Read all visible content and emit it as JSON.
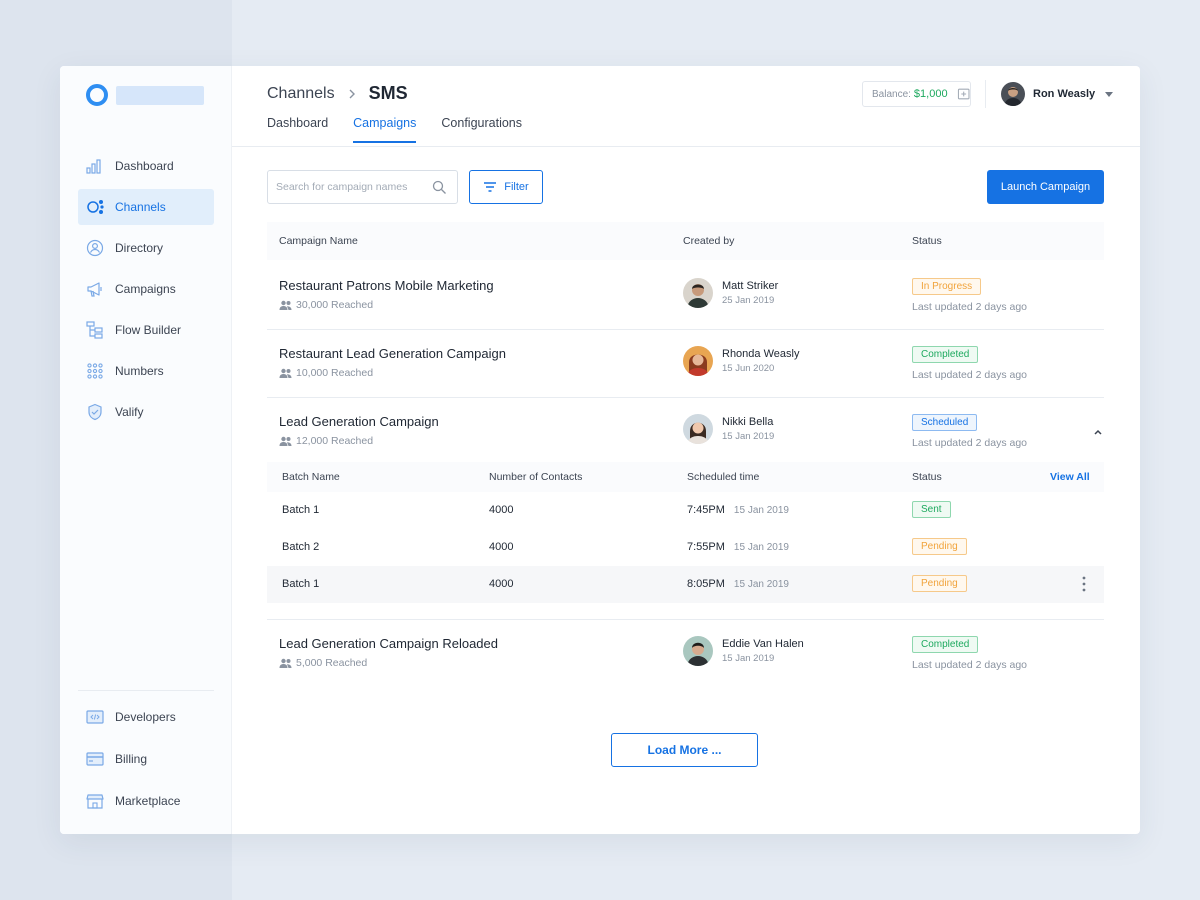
{
  "sidebar": {
    "items": [
      {
        "label": "Dashboard",
        "icon": "bar-chart-icon"
      },
      {
        "label": "Channels",
        "icon": "channels-icon",
        "active": true
      },
      {
        "label": "Directory",
        "icon": "directory-icon"
      },
      {
        "label": "Campaigns",
        "icon": "megaphone-icon"
      },
      {
        "label": "Flow Builder",
        "icon": "flow-builder-icon"
      },
      {
        "label": "Numbers",
        "icon": "dial-pad-icon"
      },
      {
        "label": "Valify",
        "icon": "shield-check-icon"
      }
    ],
    "bottom_items": [
      {
        "label": "Developers",
        "icon": "code-icon"
      },
      {
        "label": "Billing",
        "icon": "credit-card-icon"
      },
      {
        "label": "Marketplace",
        "icon": "store-icon"
      }
    ]
  },
  "header": {
    "breadcrumb_parent": "Channels",
    "breadcrumb_current": "SMS",
    "tabs": [
      {
        "label": "Dashboard"
      },
      {
        "label": "Campaigns",
        "active": true
      },
      {
        "label": "Configurations"
      }
    ],
    "balance_label": "Balance:",
    "balance_value": "$1,000",
    "user_name": "Ron Weasly"
  },
  "toolbar": {
    "search_placeholder": "Search for campaign names",
    "filter_label": "Filter",
    "launch_label": "Launch Campaign"
  },
  "table": {
    "headers": {
      "name": "Campaign Name",
      "created_by": "Created by",
      "status": "Status"
    },
    "rows": [
      {
        "name": "Restaurant Patrons Mobile Marketing",
        "reached": "30,000 Reached",
        "creator": "Matt Striker",
        "date": "25 Jan 2019",
        "status": "In Progress",
        "updated": "Last updated 2 days ago"
      },
      {
        "name": "Restaurant Lead Generation Campaign",
        "reached": "10,000 Reached",
        "creator": "Rhonda Weasly",
        "date": "15 Jun 2020",
        "status": "Completed",
        "updated": "Last updated 2 days ago"
      },
      {
        "name": "Lead Generation Campaign",
        "reached": "12,000 Reached",
        "creator": "Nikki Bella",
        "date": "15 Jan 2019",
        "status": "Scheduled",
        "updated": "Last updated 2 days ago"
      },
      {
        "name": "Lead Generation Campaign Reloaded",
        "reached": "5,000 Reached",
        "creator": "Eddie Van Halen",
        "date": "15 Jan 2019",
        "status": "Completed",
        "updated": "Last updated 2 days ago"
      }
    ]
  },
  "batches": {
    "headers": {
      "name": "Batch Name",
      "contacts": "Number of Contacts",
      "time": "Scheduled time",
      "status": "Status",
      "view_all": "View All"
    },
    "rows": [
      {
        "name": "Batch 1",
        "contacts": "4000",
        "time": "7:45PM",
        "date": "15 Jan 2019",
        "status": "Sent"
      },
      {
        "name": "Batch 2",
        "contacts": "4000",
        "time": "7:55PM",
        "date": "15 Jan 2019",
        "status": "Pending"
      },
      {
        "name": "Batch 1",
        "contacts": "4000",
        "time": "8:05PM",
        "date": "15 Jan 2019",
        "status": "Pending"
      }
    ]
  },
  "load_more": "Load More ...",
  "colors": {
    "accent": "#1672e3",
    "success": "#1ea95f",
    "warning": "#f1a33b"
  }
}
